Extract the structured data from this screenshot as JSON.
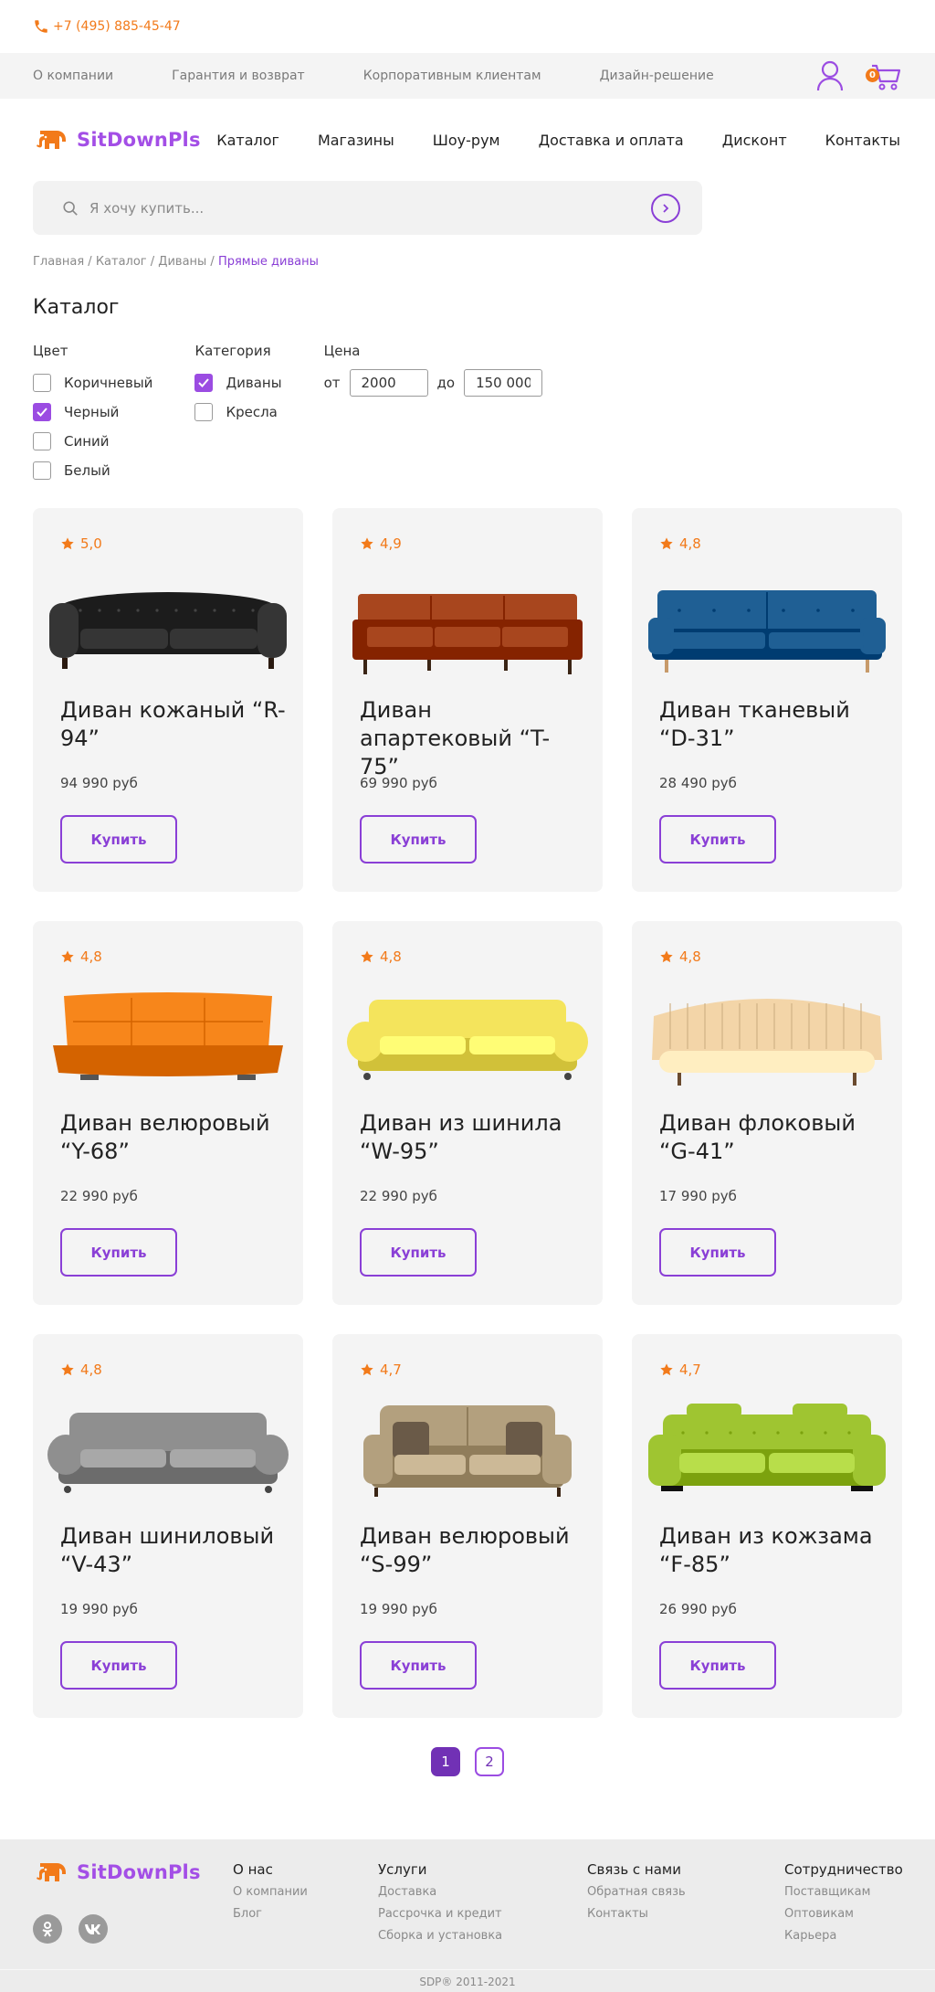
{
  "topbar": {
    "phone": "+7 (495) 885-45-47"
  },
  "subnav": {
    "links": [
      "О компании",
      "Гарантия и возврат",
      "Корпоративным клиентам",
      "Дизайн-решение"
    ],
    "cart_count": "0"
  },
  "header": {
    "logo": "SitDownPls",
    "nav": [
      "Каталог",
      "Магазины",
      "Шоу-рум",
      "Доставка и оплата",
      "Дисконт",
      "Контакты"
    ]
  },
  "search": {
    "placeholder": "Я хочу купить..."
  },
  "breadcrumb": {
    "items": [
      "Главная",
      "Каталог",
      "Диваны"
    ],
    "separator": " / ",
    "current": "Прямые диваны"
  },
  "page_title": "Каталог",
  "filters": {
    "color": {
      "title": "Цвет",
      "options": [
        {
          "label": "Коричневый",
          "checked": false
        },
        {
          "label": "Черный",
          "checked": true
        },
        {
          "label": "Синий",
          "checked": false
        },
        {
          "label": "Белый",
          "checked": false
        }
      ]
    },
    "category": {
      "title": "Категория",
      "options": [
        {
          "label": "Диваны",
          "checked": true
        },
        {
          "label": "Кресла",
          "checked": false
        }
      ]
    },
    "price": {
      "title": "Цена",
      "from_label": "от",
      "from": "2000",
      "to_label": "до",
      "to": "150 000"
    }
  },
  "products": [
    {
      "rating": "5,0",
      "name": "Диван кожаный “R-94”",
      "price": "94 990 руб",
      "buy": "Купить",
      "color": "#1c1c1c",
      "style": "chesterfield"
    },
    {
      "rating": "4,9",
      "name": "Диван апартековый “T-75”",
      "price": "69 990 руб",
      "buy": "Купить",
      "color": "#a8461e",
      "style": "boxy"
    },
    {
      "rating": "4,8",
      "name": "Диван тканевый “D-31”",
      "price": "28 490 руб",
      "buy": "Купить",
      "color": "#1f5f94",
      "style": "tufted"
    },
    {
      "rating": "4,8",
      "name": "Диван велюровый “Y-68”",
      "price": "22 990 руб",
      "buy": "Купить",
      "color": "#f7861b",
      "style": "futon"
    },
    {
      "rating": "4,8",
      "name": "Диван из шинила “W-95”",
      "price": "22 990 руб",
      "buy": "Купить",
      "color": "#f4e45c",
      "style": "rolled"
    },
    {
      "rating": "4,8",
      "name": "Диван флоковый “G-41”",
      "price": "17 990 руб",
      "buy": "Купить",
      "color": "#f3d5a8",
      "style": "shell"
    },
    {
      "rating": "4,8",
      "name": "Диван шиниловый “V-43”",
      "price": "19 990 руб",
      "buy": "Купить",
      "color": "#8f8f8f",
      "style": "rolled"
    },
    {
      "rating": "4,7",
      "name": "Диван велюровый “S-99”",
      "price": "19 990 руб",
      "buy": "Купить",
      "color": "#b3a07e",
      "style": "pillows"
    },
    {
      "rating": "4,7",
      "name": "Диван из кожзама “F-85”",
      "price": "26 990 руб",
      "buy": "Купить",
      "color": "#9fc531",
      "style": "modern"
    }
  ],
  "pagination": {
    "pages": [
      "1",
      "2"
    ],
    "current": "1"
  },
  "footer": {
    "logo": "SitDownPls",
    "columns": [
      {
        "title": "О нас",
        "links": [
          "О компании",
          "Блог"
        ]
      },
      {
        "title": "Услуги",
        "links": [
          "Доставка",
          "Рассрочка и кредит",
          "Сборка и установка"
        ]
      },
      {
        "title": "Связь с нами",
        "links": [
          "Обратная связь",
          "Контакты"
        ]
      },
      {
        "title": "Сотрудничество",
        "links": [
          "Поставщикам",
          "Оптовикам",
          "Карьера"
        ]
      }
    ],
    "copyright": "SDP®   2011-2021"
  },
  "colors": {
    "accent": "#8a3fd6",
    "orange": "#f27a1a"
  }
}
